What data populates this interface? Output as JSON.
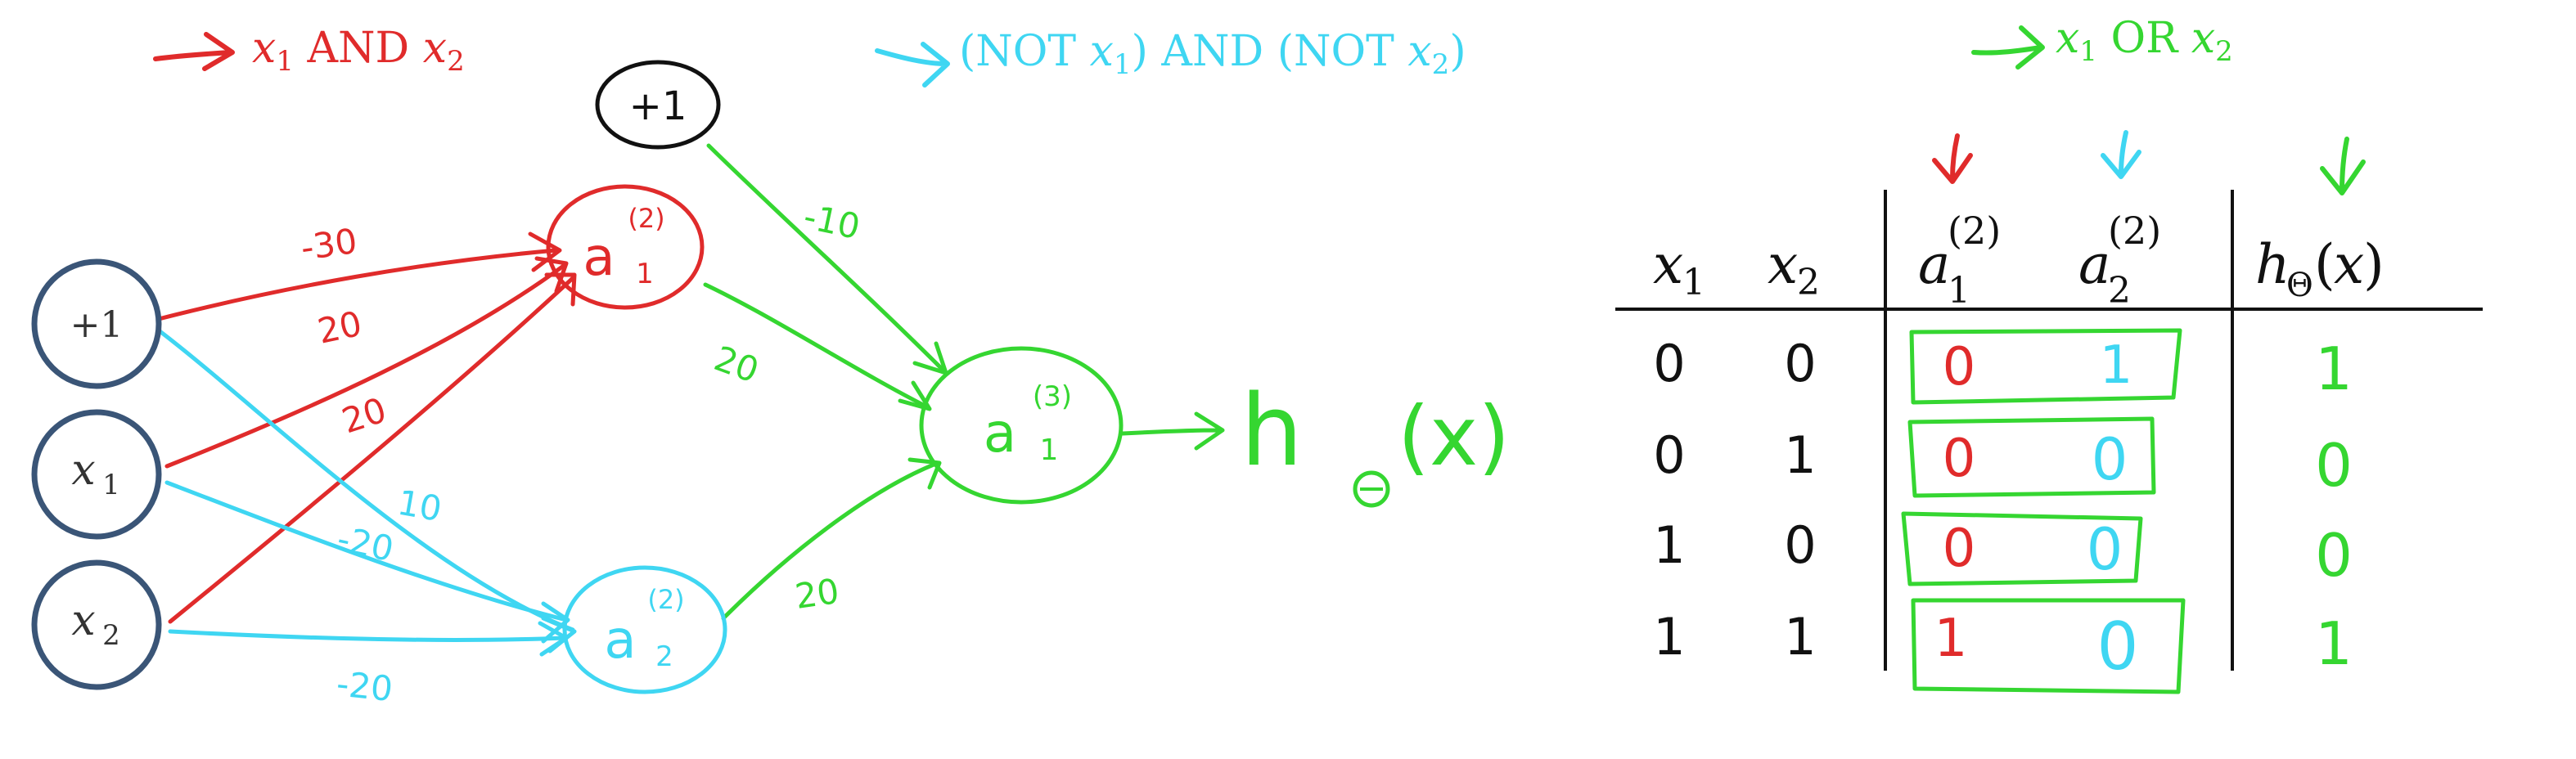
{
  "colors": {
    "red": "#e02b2b",
    "cyan": "#3fd6f2",
    "green": "#35d631",
    "node_border": "#3a5577",
    "black": "#111111"
  },
  "captions": {
    "and": "x1 AND x2",
    "nor": "(NOT x1) AND (NOT x2)",
    "or": "x1 OR x2"
  },
  "network": {
    "input_nodes": [
      "+1",
      "x1",
      "x2"
    ],
    "bias_hidden": "+1",
    "hidden_nodes": [
      "a1(2)",
      "a2(2)"
    ],
    "output_node": "a1(3)",
    "output_label": "hΘ(x)",
    "weights_to_a1": [
      "-30",
      "20",
      "20"
    ],
    "weights_to_a2": [
      "10",
      "-20",
      "-20"
    ],
    "weights_to_out": [
      "-10",
      "20",
      "20"
    ]
  },
  "table": {
    "headers": [
      "x1",
      "x2",
      "a1(2)",
      "a2(2)",
      "hΘ(x)"
    ],
    "rows": [
      [
        "0",
        "0",
        "0",
        "1",
        "1"
      ],
      [
        "0",
        "1",
        "0",
        "0",
        "0"
      ],
      [
        "1",
        "0",
        "0",
        "0",
        "0"
      ],
      [
        "1",
        "1",
        "1",
        "0",
        "1"
      ]
    ]
  }
}
